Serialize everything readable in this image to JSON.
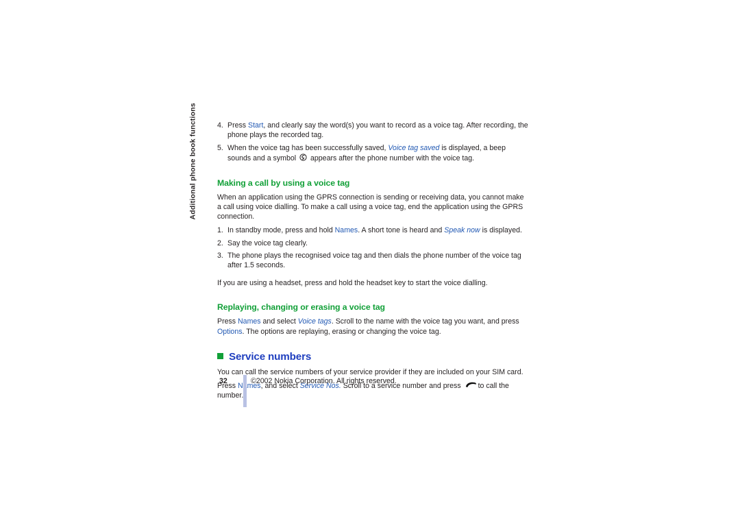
{
  "document": {
    "running_head": "Additional phone book functions",
    "page_number": "32",
    "copyright": "©2002 Nokia Corporation. All rights reserved."
  },
  "steps_continued": [
    {
      "number": "4.",
      "parts": [
        {
          "t": "Press ",
          "style": "plain"
        },
        {
          "t": "Start",
          "style": "ui"
        },
        {
          "t": ", and clearly say the word(s) you want to record as a voice tag. After recording, the phone plays the recorded tag.",
          "style": "plain"
        }
      ]
    },
    {
      "number": "5.",
      "parts": [
        {
          "t": "When the voice tag has been successfully saved, ",
          "style": "plain"
        },
        {
          "t": "Voice tag saved",
          "style": "msg"
        },
        {
          "t": " is displayed, a beep sounds and a symbol ",
          "style": "plain"
        },
        {
          "t": "",
          "style": "icon-voicetag"
        },
        {
          "t": " appears after the phone number with the voice tag.",
          "style": "plain"
        }
      ]
    }
  ],
  "section_making_call": {
    "heading": "Making a call by using a voice tag",
    "intro": "When an application using the GPRS connection is sending or receiving data, you cannot make a call using voice dialling. To make a call using a voice tag, end the application using the GPRS connection.",
    "steps": [
      {
        "number": "1.",
        "parts": [
          {
            "t": "In standby mode, press and hold ",
            "style": "plain"
          },
          {
            "t": "Names",
            "style": "ui"
          },
          {
            "t": ". A short tone is heard and ",
            "style": "plain"
          },
          {
            "t": "Speak now",
            "style": "msg"
          },
          {
            "t": " is displayed.",
            "style": "plain"
          }
        ]
      },
      {
        "number": "2.",
        "parts": [
          {
            "t": "Say the voice tag clearly.",
            "style": "plain"
          }
        ]
      },
      {
        "number": "3.",
        "parts": [
          {
            "t": "The phone plays the recognised voice tag and then dials the phone number of the voice tag after 1.5 seconds.",
            "style": "plain"
          }
        ]
      }
    ],
    "note": "If you are using a headset, press and hold the headset key to start the voice dialling."
  },
  "section_replaying": {
    "heading": "Replaying, changing or erasing a voice tag",
    "body_parts": [
      {
        "t": "Press ",
        "style": "plain"
      },
      {
        "t": "Names",
        "style": "ui"
      },
      {
        "t": " and select ",
        "style": "plain"
      },
      {
        "t": "Voice tags",
        "style": "msg"
      },
      {
        "t": ". Scroll to the name with the voice tag you want, and press ",
        "style": "plain"
      },
      {
        "t": "Options",
        "style": "ui"
      },
      {
        "t": ". The options are replaying, erasing or changing the voice tag.",
        "style": "plain"
      }
    ]
  },
  "section_service_numbers": {
    "heading": "Service numbers",
    "bullet_color": "#12a038",
    "heading_color": "#1f3fbf",
    "intro": "You can call the service numbers of your service provider if they are included on your SIM card.",
    "body_parts": [
      {
        "t": "Press ",
        "style": "plain"
      },
      {
        "t": "Names",
        "style": "ui"
      },
      {
        "t": ", and select ",
        "style": "plain"
      },
      {
        "t": "Service Nos.",
        "style": "msg"
      },
      {
        "t": " Scroll to a service number and press ",
        "style": "plain"
      },
      {
        "t": "",
        "style": "icon-handset"
      },
      {
        "t": "to call the number.",
        "style": "plain"
      }
    ]
  },
  "colors": {
    "green_heading": "#12a038",
    "blue_heading": "#1f3fbf",
    "blue_inline": "#2259b3",
    "body_text": "#231f20",
    "footer_rule": "#b9c2e4",
    "page_background": "#ffffff"
  }
}
